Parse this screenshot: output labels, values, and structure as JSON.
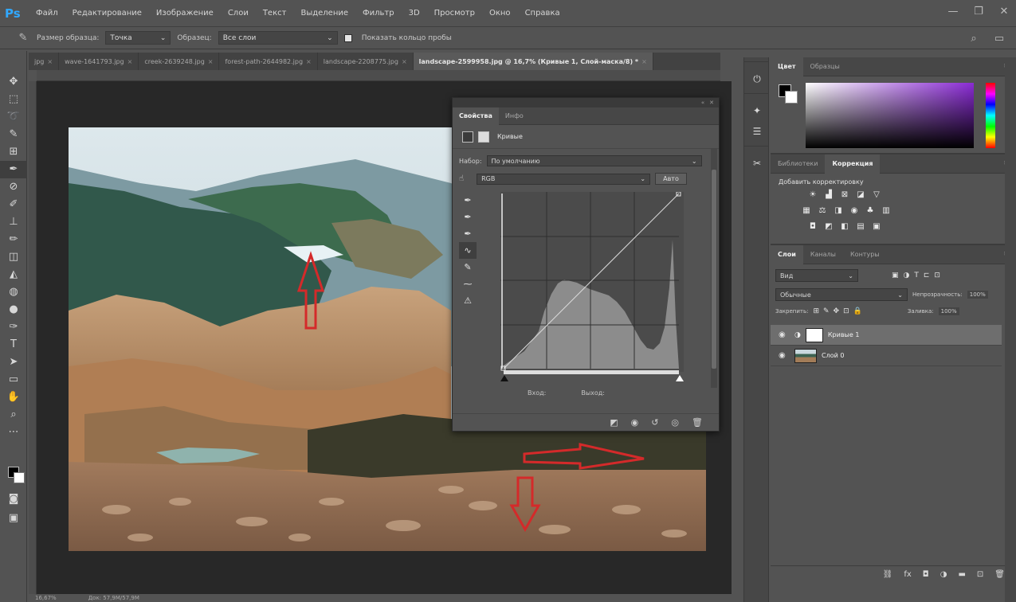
{
  "app": {
    "logo": "Ps"
  },
  "menu": [
    "Файл",
    "Редактирование",
    "Изображение",
    "Слои",
    "Текст",
    "Выделение",
    "Фильтр",
    "3D",
    "Просмотр",
    "Окно",
    "Справка"
  ],
  "window_controls": [
    "—",
    "❐",
    "✕"
  ],
  "options": {
    "sample_size_label": "Размер образца:",
    "sample_size_value": "Точка",
    "samples_label": "Образец:",
    "samples_value": "Все слои",
    "show_ring_label": "Показать кольцо пробы"
  },
  "tabs": [
    {
      "label": "jpg",
      "active": false
    },
    {
      "label": "wave-1641793.jpg",
      "active": false
    },
    {
      "label": "creek-2639248.jpg",
      "active": false
    },
    {
      "label": "forest-path-2644982.jpg",
      "active": false
    },
    {
      "label": "landscape-2208775.jpg",
      "active": false
    },
    {
      "label": "landscape-2599958.jpg @ 16,7% (Кривые 1, Слой-маска/8) *",
      "active": true
    }
  ],
  "tab_close": "×",
  "status": {
    "zoom": "16,67%",
    "doc": "Док: 57,9М/57,9М"
  },
  "properties": {
    "tabs": [
      "Свойства",
      "Инфо"
    ],
    "header_title": "Кривые",
    "preset_label": "Набор:",
    "preset_value": "По умолчанию",
    "channel_value": "RGB",
    "auto_label": "Авто",
    "input_label": "Вход:",
    "output_label": "Выход:"
  },
  "right": {
    "color_tabs": [
      "Цвет",
      "Образцы"
    ],
    "adj_tabs": [
      "Библиотеки",
      "Коррекция"
    ],
    "adj_title": "Добавить корректировку",
    "layers_tabs": [
      "Слои",
      "Каналы",
      "Контуры"
    ],
    "kind_value": "Вид",
    "blend_value": "Обычные",
    "opacity_label": "Непрозрачность:",
    "opacity_value": "100%",
    "lock_label": "Закрепить:",
    "fill_label": "Заливка:",
    "fill_value": "100%",
    "layers": [
      {
        "name": "Кривые 1",
        "selected": true
      },
      {
        "name": "Слой 0",
        "selected": false
      }
    ]
  },
  "colors": {
    "accent": "#31a8ff",
    "annotation": "#d42a2a"
  }
}
